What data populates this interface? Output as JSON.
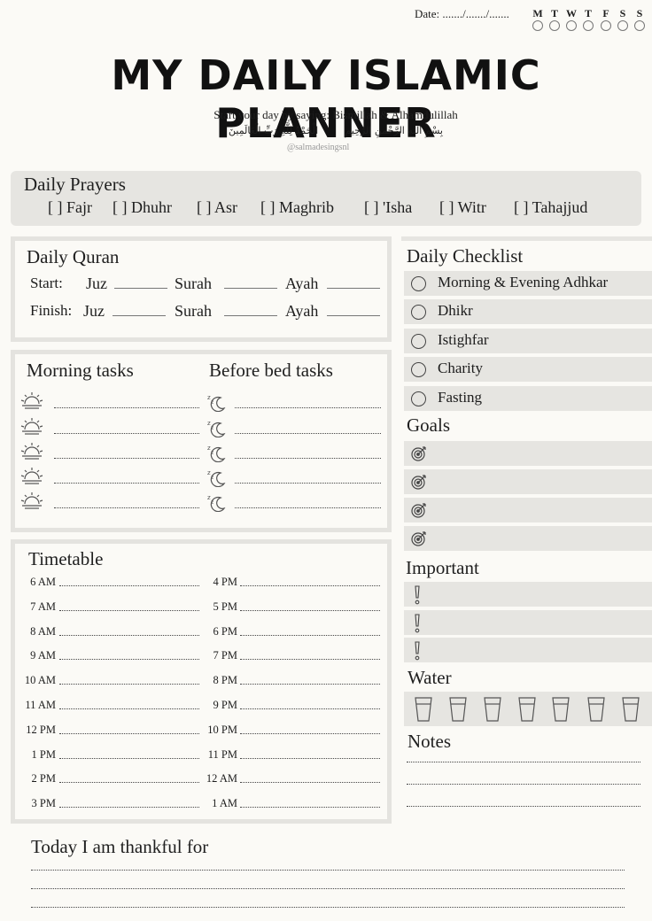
{
  "header": {
    "date_label": "Date: ......./......./.......",
    "weekdays": [
      "M",
      "T",
      "W",
      "T",
      "F",
      "S",
      "S"
    ],
    "title": "MY DAILY ISLAMIC PLANNER",
    "subtitle": "Start your day by saying: Bismillah & Alhamdulillah",
    "arabic_left": "الْحَمْدُ لِلَّهِ رَبِّ الْعَالَمِينَ",
    "arabic_right": "بِسْمِ اللهِ الرَّحْمنِ الرَّحِيمِ",
    "credit": "@salmadesingsnl"
  },
  "prayers": {
    "title": "Daily Prayers",
    "items": [
      "[ ] Fajr",
      "[ ] Dhuhr",
      "[ ] Asr",
      "[ ] Maghrib",
      "[ ] 'Isha",
      "[ ] Witr",
      "[ ] Tahajjud"
    ]
  },
  "quran": {
    "title": "Daily Quran",
    "start_label": "Start:",
    "finish_label": "Finish:",
    "juz": "Juz",
    "surah": "Surah",
    "ayah": "Ayah"
  },
  "tasks": {
    "morning_title": "Morning tasks",
    "bed_title": "Before bed tasks"
  },
  "timetable": {
    "title": "Timetable",
    "left": [
      "6 AM",
      "7 AM",
      "8 AM",
      "9 AM",
      "10 AM",
      "11 AM",
      "12 PM",
      "1 PM",
      "2 PM",
      "3 PM"
    ],
    "right": [
      "4 PM",
      "5 PM",
      "6 PM",
      "7 PM",
      "8 PM",
      "9 PM",
      "10 PM",
      "11 PM",
      "12 AM",
      "1 AM"
    ]
  },
  "checklist": {
    "title": "Daily Checklist",
    "items": [
      "Morning & Evening Adhkar",
      "Dhikr",
      "Istighfar",
      "Charity",
      "Fasting"
    ]
  },
  "goals": {
    "title": "Goals"
  },
  "important": {
    "title": "Important"
  },
  "water": {
    "title": "Water"
  },
  "notes": {
    "title": "Notes"
  },
  "thankful": {
    "title": "Today I am thankful for"
  },
  "icons": {
    "goal": "target-icon",
    "important": "exclamation-icon",
    "water": "glass-icon",
    "morning": "sunrise-icon",
    "bed": "moon-sleep-icon"
  }
}
